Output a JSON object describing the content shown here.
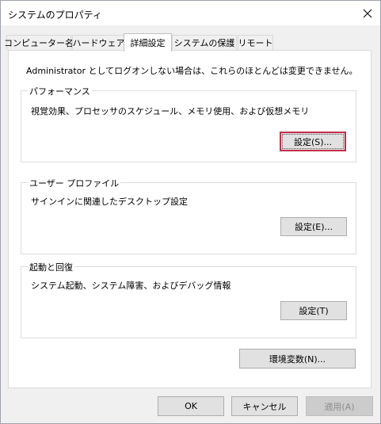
{
  "window": {
    "title": "システムのプロパティ"
  },
  "tabs": [
    {
      "label": "コンピューター名"
    },
    {
      "label": "ハードウェア"
    },
    {
      "label": "詳細設定"
    },
    {
      "label": "システムの保護"
    },
    {
      "label": "リモート"
    }
  ],
  "active_tab": "詳細設定",
  "panel": {
    "note": "Administrator としてログオンしない場合は、これらのほとんどは変更できません。",
    "performance": {
      "title": "パフォーマンス",
      "description": "視覚効果、プロセッサのスケジュール、メモリ使用、および仮想メモリ",
      "button": "設定(S)..."
    },
    "user_profile": {
      "title": "ユーザー プロファイル",
      "description": "サインインに関連したデスクトップ設定",
      "button": "設定(E)..."
    },
    "startup": {
      "title": "起動と回復",
      "description": "システム起動、システム障害、およびデバッグ情報",
      "button": "設定(T)"
    },
    "env_button": "環境変数(N)..."
  },
  "footer": {
    "ok": "OK",
    "cancel": "キャンセル",
    "apply": "適用(A)"
  },
  "colors": {
    "dialog_bg": "#f0f0f0",
    "panel_bg": "#ffffff",
    "focus_border": "#c22f4b",
    "button_bg": "#e1e1e1"
  }
}
